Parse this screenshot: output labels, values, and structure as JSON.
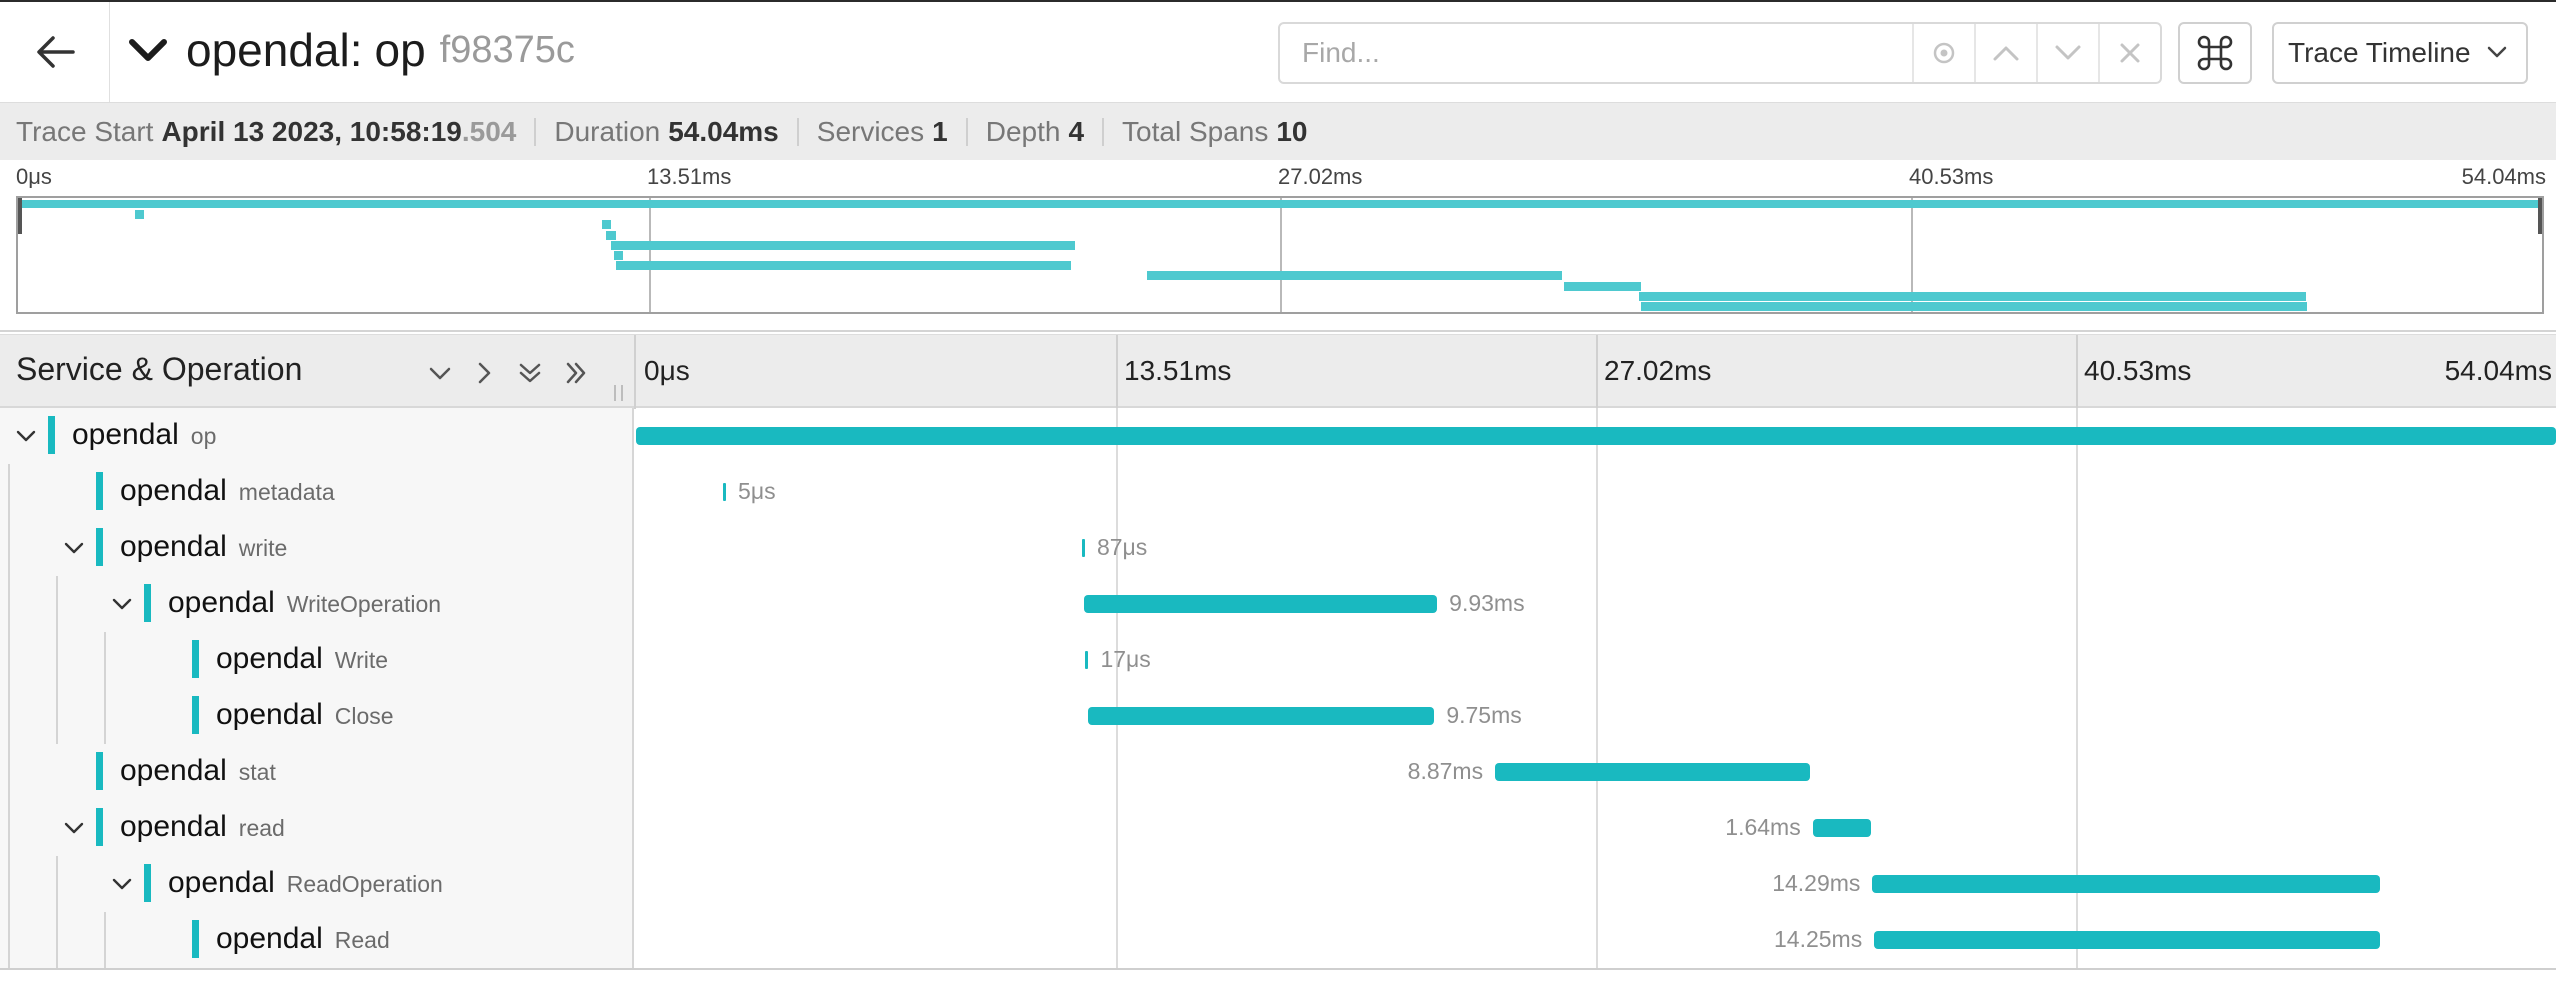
{
  "header": {
    "service": "opendal",
    "separator": ":",
    "operation": "op",
    "trace_id": "f98375c",
    "find_placeholder": "Find...",
    "view_label": "Trace Timeline"
  },
  "summary": {
    "trace_start_label": "Trace Start",
    "trace_start_value": "April 13 2023, 10:58:19",
    "trace_start_ms": ".504",
    "duration_label": "Duration",
    "duration_value": "54.04ms",
    "services_label": "Services",
    "services_value": "1",
    "depth_label": "Depth",
    "depth_value": "4",
    "total_spans_label": "Total Spans",
    "total_spans_value": "10"
  },
  "timeline": {
    "ticks": [
      "0μs",
      "13.51ms",
      "27.02ms",
      "40.53ms",
      "54.04ms"
    ],
    "service_operation_label": "Service & Operation",
    "accent_color": "#19b9c0",
    "minimap_color": "#4ec9cf",
    "total_ms": 54.04
  },
  "minimap_spans": [
    {
      "start": 0.0,
      "duration": 54.04,
      "row": 0
    },
    {
      "start": 2.5,
      "duration": 0.2,
      "row": 1
    },
    {
      "start": 12.5,
      "duration": 0.2,
      "row": 2
    },
    {
      "start": 12.6,
      "duration": 0.2,
      "row": 3
    },
    {
      "start": 12.7,
      "duration": 9.93,
      "row": 4
    },
    {
      "start": 12.75,
      "duration": 0.2,
      "row": 5
    },
    {
      "start": 12.8,
      "duration": 9.75,
      "row": 6
    },
    {
      "start": 24.18,
      "duration": 8.87,
      "row": 7
    },
    {
      "start": 33.1,
      "duration": 1.64,
      "row": 8
    },
    {
      "start": 34.7,
      "duration": 14.29,
      "row": 9
    },
    {
      "start": 34.75,
      "duration": 14.25,
      "row": 10
    }
  ],
  "spans": [
    {
      "service": "opendal",
      "operation": "op",
      "depth": 0,
      "has_children": true,
      "start": 0.0,
      "duration": 54.04,
      "label": "",
      "label_side": "right"
    },
    {
      "service": "opendal",
      "operation": "metadata",
      "depth": 1,
      "has_children": false,
      "start": 2.45,
      "duration": 0.005,
      "label": "5μs",
      "label_side": "right"
    },
    {
      "service": "opendal",
      "operation": "write",
      "depth": 1,
      "has_children": true,
      "start": 12.55,
      "duration": 0.087,
      "label": "87μs",
      "label_side": "right"
    },
    {
      "service": "opendal",
      "operation": "WriteOperation",
      "depth": 2,
      "has_children": true,
      "start": 12.62,
      "duration": 9.93,
      "label": "9.93ms",
      "label_side": "right"
    },
    {
      "service": "opendal",
      "operation": "Write",
      "depth": 3,
      "has_children": false,
      "start": 12.65,
      "duration": 0.017,
      "label": "17μs",
      "label_side": "right"
    },
    {
      "service": "opendal",
      "operation": "Close",
      "depth": 3,
      "has_children": false,
      "start": 12.72,
      "duration": 9.75,
      "label": "9.75ms",
      "label_side": "right"
    },
    {
      "service": "opendal",
      "operation": "stat",
      "depth": 1,
      "has_children": false,
      "start": 24.18,
      "duration": 8.87,
      "label": "8.87ms",
      "label_side": "left"
    },
    {
      "service": "opendal",
      "operation": "read",
      "depth": 1,
      "has_children": true,
      "start": 33.12,
      "duration": 1.64,
      "label": "1.64ms",
      "label_side": "left"
    },
    {
      "service": "opendal",
      "operation": "ReadOperation",
      "depth": 2,
      "has_children": true,
      "start": 34.8,
      "duration": 14.29,
      "label": "14.29ms",
      "label_side": "left"
    },
    {
      "service": "opendal",
      "operation": "Read",
      "depth": 3,
      "has_children": false,
      "start": 34.85,
      "duration": 14.25,
      "label": "14.25ms",
      "label_side": "left"
    }
  ],
  "icons": {
    "back": "arrow-left-icon",
    "title_toggle": "chevron-down-icon",
    "locate": "target-icon",
    "prev": "chevron-up-icon",
    "next": "chevron-down-icon",
    "clear": "close-icon",
    "shortcuts": "command-icon",
    "view_dropdown": "chevron-down-icon"
  }
}
